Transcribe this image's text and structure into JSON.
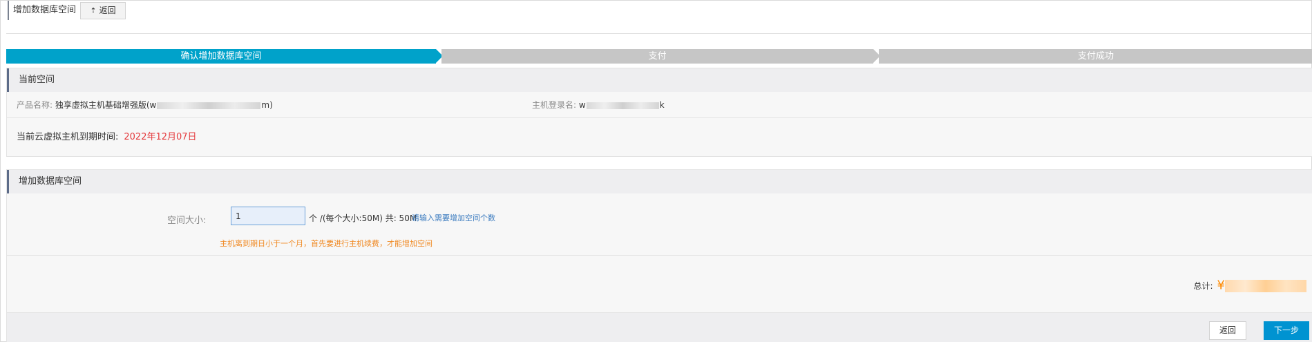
{
  "header": {
    "title": "增加数据库空间",
    "back_label": "返回"
  },
  "steps": [
    {
      "label": "确认增加数据库空间",
      "active": true
    },
    {
      "label": "支付",
      "active": false
    },
    {
      "label": "支付成功",
      "active": false
    }
  ],
  "current_space": {
    "section_title": "当前空间",
    "product_label": "产品名称:",
    "product_value_prefix": "独享虚拟主机基础增强版(w",
    "product_value_suffix": "m)",
    "login_label": "主机登录名:",
    "login_value_prefix": "w",
    "login_value_suffix": "k",
    "expire_label": "当前云虚拟主机到期时间:",
    "expire_value": "2022年12月07日"
  },
  "add_space": {
    "section_title": "增加数据库空间",
    "size_label": "空间大小:",
    "size_value": "1",
    "unit_text": "个 /(每个大小:50M) 共: 50M",
    "hint_link": "请输入需要增加空间个数",
    "warning": "主机离到期日小于一个月，首先要进行主机续费，才能增加空间",
    "total_label": "总计:",
    "currency_symbol": "¥"
  },
  "footer": {
    "back_label": "返回",
    "next_label": "下一步"
  },
  "colors": {
    "active_step": "#00a2ca",
    "inactive_step": "#c6c6c6",
    "expire_red": "#e4393c",
    "warning_orange": "#f08a24",
    "link_blue": "#3b7bbf",
    "next_button": "#0093d1",
    "price_orange": "#ff8a00"
  }
}
